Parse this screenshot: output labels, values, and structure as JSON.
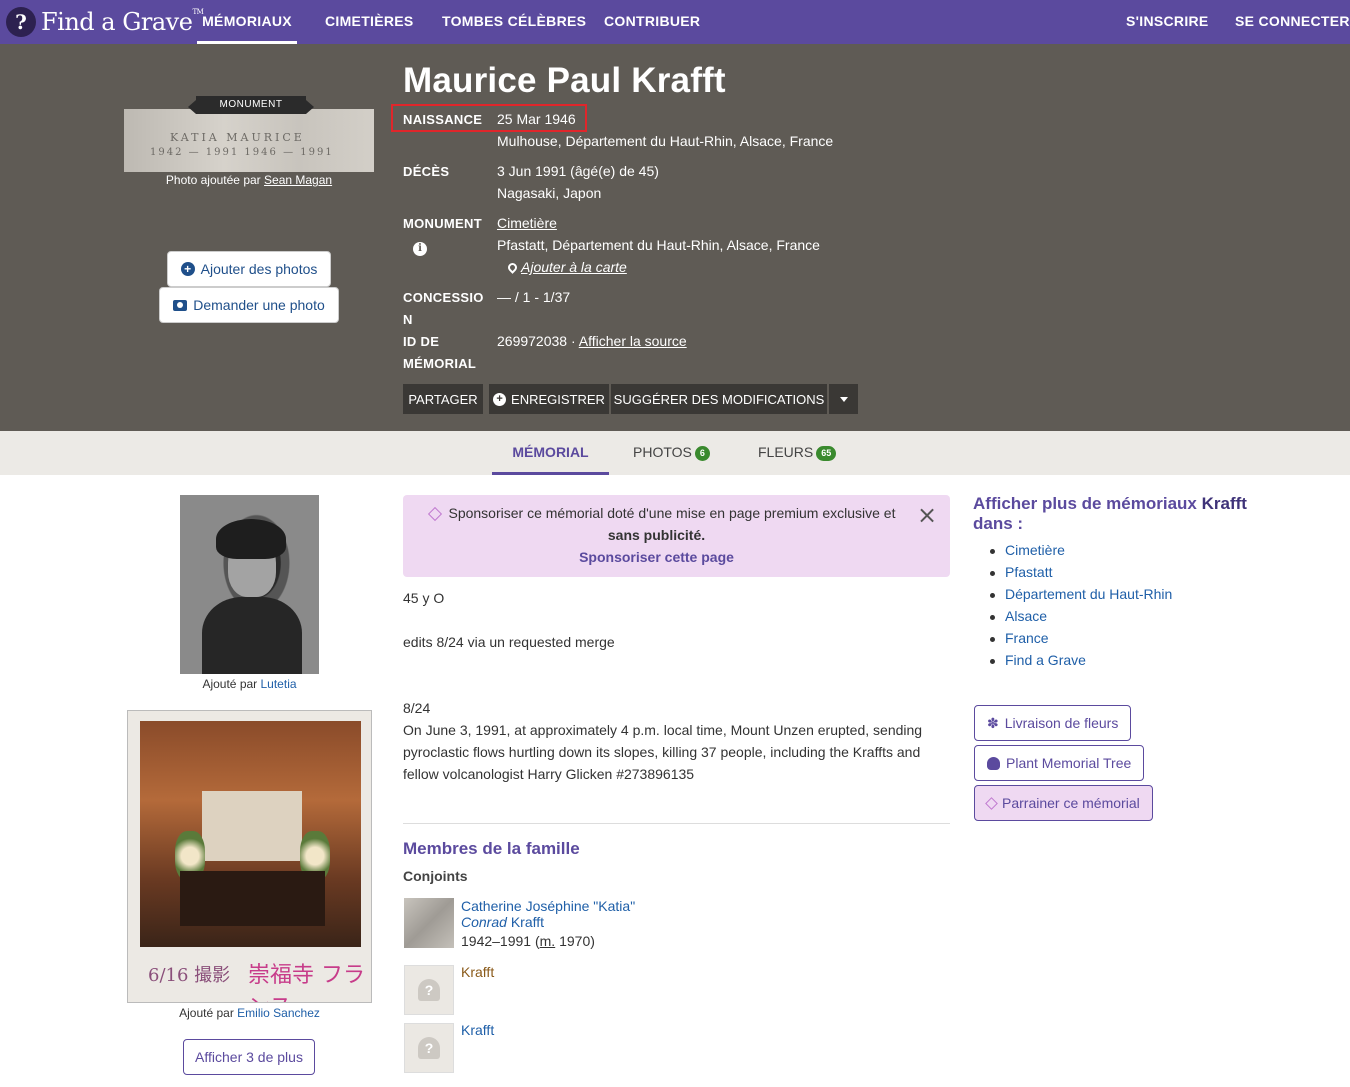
{
  "nav": {
    "logo_text": "Find a Grave",
    "logo_tm": "TM",
    "items": [
      "MÉMORIAUX",
      "CIMETIÈRES",
      "TOMBES CÉLÈBRES",
      "CONTRIBUER"
    ],
    "signup": "S'INSCRIRE",
    "login": "SE CONNECTER"
  },
  "hero": {
    "ribbon": "MONUMENT",
    "stone_line1": "KATIA     MAURICE",
    "stone_line2": "1942 — 1991   1946 — 1991",
    "photo_added_by": "Photo ajoutée par",
    "photo_author": "Sean Magan",
    "add_photos": "Ajouter des photos",
    "request_photo": "Demander une photo",
    "name": "Maurice Paul Krafft",
    "birth_label": "NAISSANCE",
    "birth_date": "25 Mar 1946",
    "birth_place": "Mulhouse, Département du Haut-Rhin, Alsace, France",
    "death_label": "DÉCÈS",
    "death_date": "3 Jun 1991 (âgé(e) de 45)",
    "death_place": "Nagasaki, Japon",
    "monument_label": "MONUMENT",
    "monument_link": "Cimetière",
    "monument_place": "Pfastatt, Département du Haut-Rhin, Alsace, France",
    "map_link": "Ajouter à la carte",
    "concession_label_1": "CONCESSIO",
    "concession_label_2": "N",
    "concession_value": "— / 1 - 1/37",
    "memorial_id_label_1": "ID DE",
    "memorial_id_label_2": "MÉMORIAL",
    "memorial_id": "269972038 ·",
    "source_link": "Afficher la source",
    "share": "PARTAGER",
    "save": "ENREGISTRER",
    "suggest": "SUGGÉRER DES MODIFICATIONS"
  },
  "tabs": {
    "memorial": "MÉMORIAL",
    "photos": "PHOTOS",
    "photos_count": "6",
    "flowers": "FLEURS",
    "flowers_count": "65"
  },
  "left": {
    "added_by": "Ajouté par",
    "photo1_author": "Lutetia",
    "photo2_author": "Emilio Sanchez",
    "polaroid_text1": "6/16 撮影",
    "polaroid_text2": "崇福寺 フランス",
    "show_more": "Afficher 3 de plus"
  },
  "sponsor": {
    "line1": "Sponsoriser ce mémorial doté d'une mise en page premium exclusive et",
    "line2": "sans publicité.",
    "link": "Sponsoriser cette page",
    "close": "×"
  },
  "bio": {
    "p1": "45 y O",
    "p2": "edits 8/24 via un requested merge",
    "p3": "8/24",
    "p4": "On June 3, 1991, at approximately 4 p.m. local time, Mount Unzen erupted, sending",
    "p5": "pyroclastic flows hurtling down its slopes, killing 37 people, including the Kraffts and",
    "p6": "fellow volcanologist Harry Glicken #273896135"
  },
  "family": {
    "title": "Membres de la famille",
    "spouses": "Conjoints",
    "spouse_name1": "Catherine Joséphine \"Katia\"",
    "spouse_name2_italic": "Conrad",
    "spouse_name2": "Krafft",
    "spouse_dates": "1942–1991 (",
    "spouse_m": "m.",
    "spouse_year": " 1970)",
    "rel2": "Krafft",
    "rel3": "Krafft",
    "placeholder": "?"
  },
  "right": {
    "title_part1": "Afficher plus de mémoriaux",
    "title_name": "Krafft",
    "title_part2": "dans :",
    "links": [
      "Cimetière",
      "Pfastatt",
      "Département du Haut-Rhin",
      "Alsace",
      "France",
      "Find a Grave"
    ],
    "flowers_btn": "Livraison de fleurs",
    "tree_btn": "Plant Memorial Tree",
    "sponsor_btn": "Parrainer ce mémorial"
  }
}
